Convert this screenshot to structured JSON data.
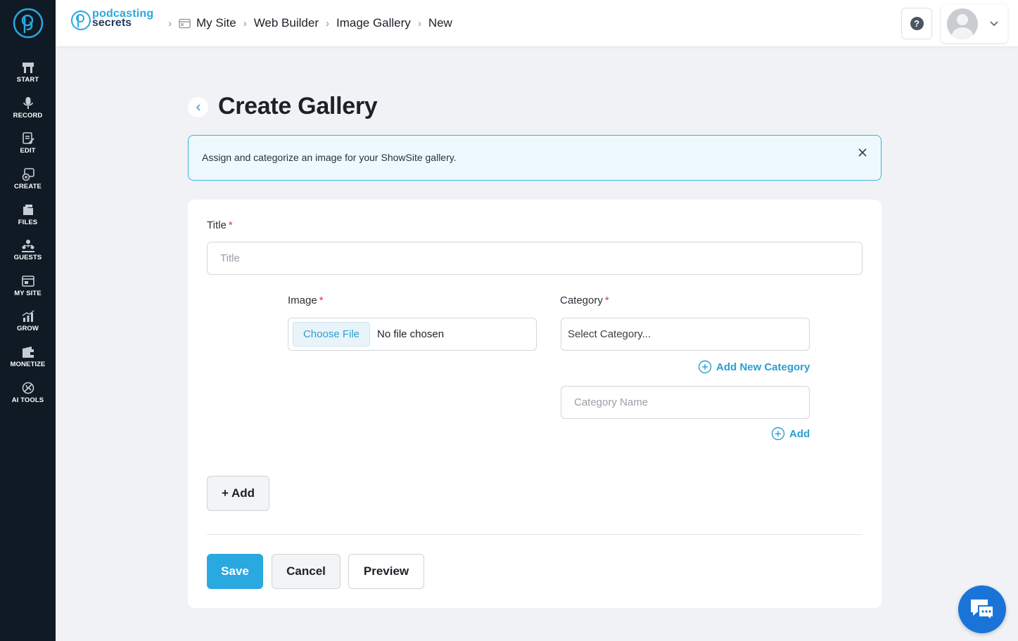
{
  "sidebar": {
    "items": [
      {
        "label": "START",
        "icon": "start-icon"
      },
      {
        "label": "RECORD",
        "icon": "microphone-icon"
      },
      {
        "label": "EDIT",
        "icon": "edit-icon"
      },
      {
        "label": "CREATE",
        "icon": "create-icon"
      },
      {
        "label": "FILES",
        "icon": "files-icon"
      },
      {
        "label": "GUESTS",
        "icon": "guests-icon"
      },
      {
        "label": "MY SITE",
        "icon": "my-site-icon"
      },
      {
        "label": "GROW",
        "icon": "grow-icon"
      },
      {
        "label": "MONETIZE",
        "icon": "monetize-icon"
      },
      {
        "label": "AI TOOLS",
        "icon": "ai-tools-icon"
      }
    ]
  },
  "header": {
    "brand_line1": "podcasting",
    "brand_line2": "secrets",
    "breadcrumb": [
      "My Site",
      "Web Builder",
      "Image Gallery",
      "New"
    ],
    "help_glyph": "?"
  },
  "page": {
    "title": "Create Gallery"
  },
  "notice": {
    "text": "Assign and categorize an image for your ShowSite gallery."
  },
  "form": {
    "title_label": "Title",
    "title_placeholder": "Title",
    "required_mark": "*",
    "image_label": "Image",
    "file_button": "Choose File",
    "file_status": "No file chosen",
    "category_label": "Category",
    "category_select": "Select Category...",
    "add_new_category": "Add New Category",
    "category_name_placeholder": "Category Name",
    "add_label": "Add",
    "add_button": "+ Add"
  },
  "actions": {
    "save": "Save",
    "cancel": "Cancel",
    "preview": "Preview"
  },
  "colors": {
    "sidebar_bg": "#0f1a24",
    "accent": "#2aa8e0",
    "chat": "#1a74d8",
    "required": "#e0324a"
  }
}
